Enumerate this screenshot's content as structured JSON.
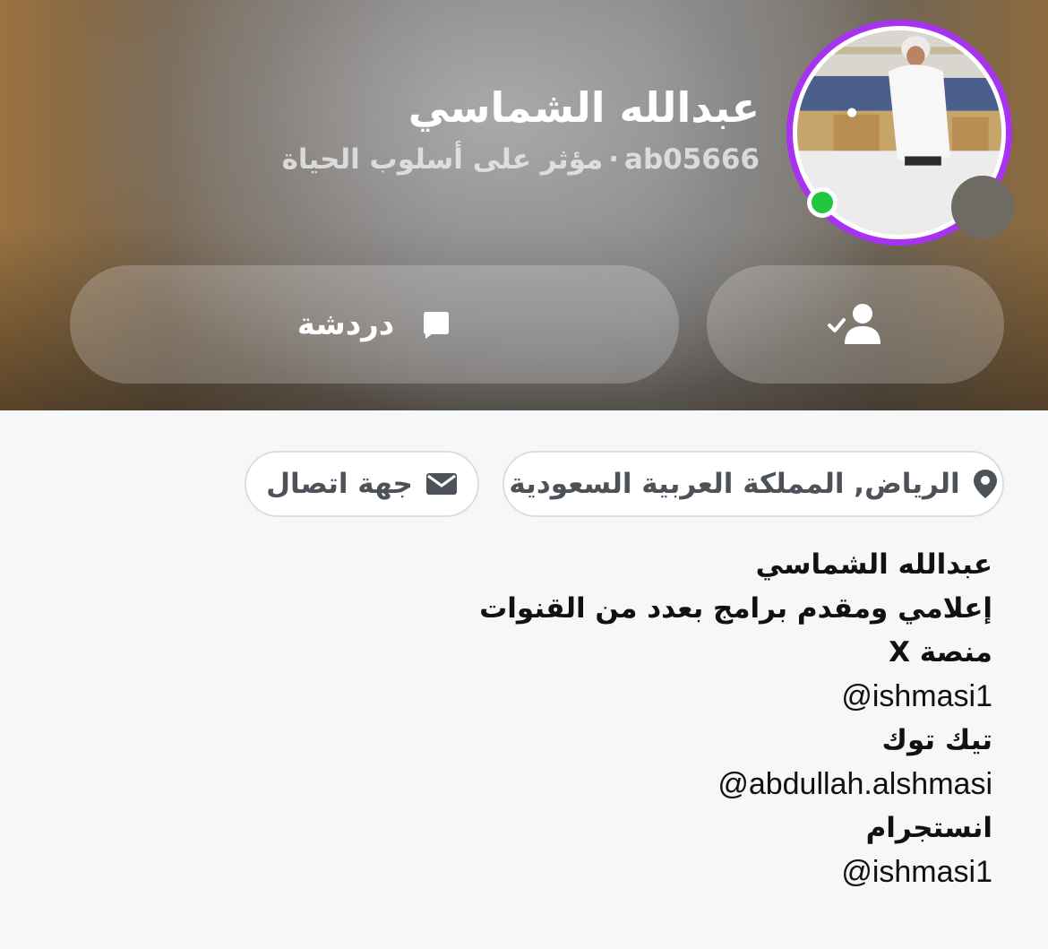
{
  "profile": {
    "display_name": "عبدالله الشماسي",
    "username": "ab05666",
    "separator": "·",
    "category": "مؤثر على أسلوب الحياة",
    "online": true
  },
  "actions": {
    "chat_label": "دردشة"
  },
  "info": {
    "location": "الرياض, المملكة العربية السعودية",
    "contact": "جهة اتصال"
  },
  "bio": [
    {
      "text": "عبدالله الشماسي",
      "bold": true
    },
    {
      "text": "إعلامي ومقدم برامج بعدد من القنوات",
      "bold": true
    },
    {
      "text": "منصة X",
      "bold": true
    },
    {
      "text": "@ishmasi1",
      "bold": false
    },
    {
      "text": "تيك توك",
      "bold": true
    },
    {
      "text": "@abdullah.alshmasi",
      "bold": false
    },
    {
      "text": "انستجرام",
      "bold": true
    },
    {
      "text": "@ishmasi1",
      "bold": false
    }
  ],
  "colors": {
    "story_ring": "#a832f2",
    "online": "#21c73e",
    "chip_text": "#4d5259"
  }
}
